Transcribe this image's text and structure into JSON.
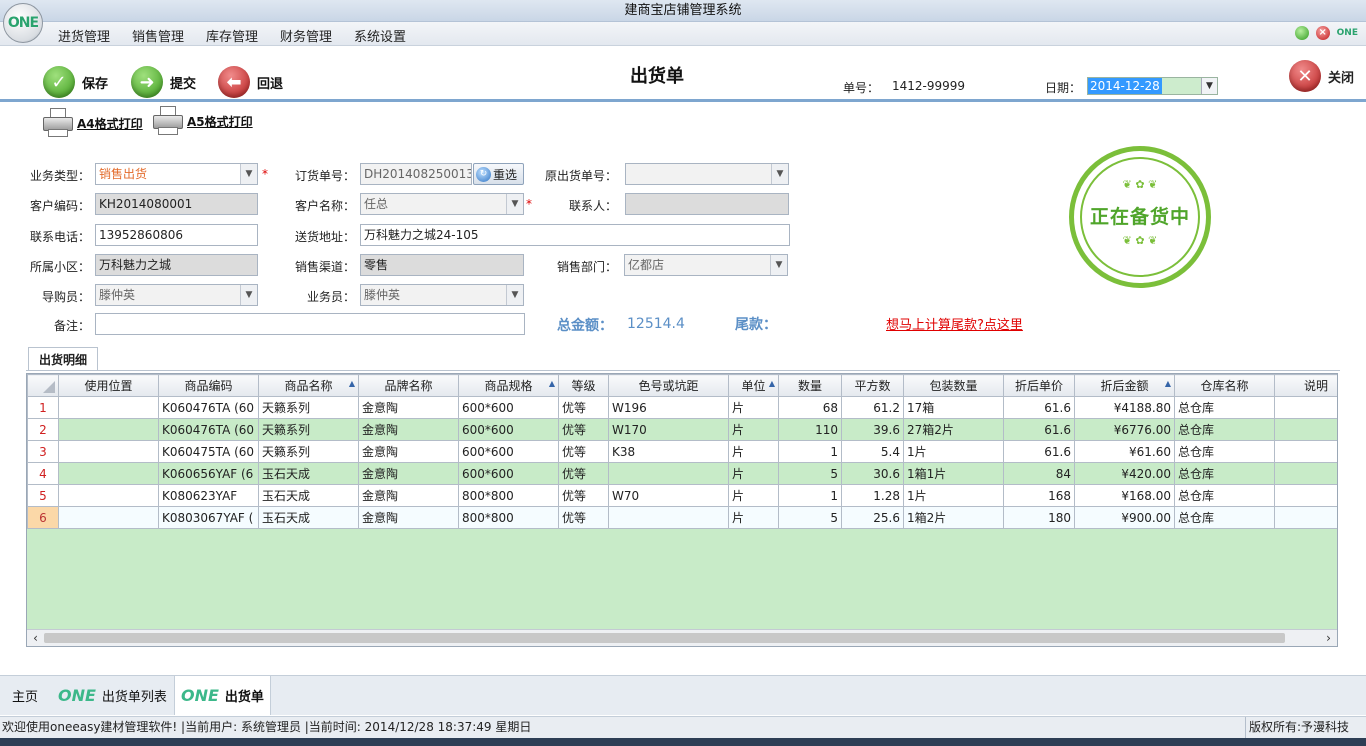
{
  "app": {
    "title": "建商宝店铺管理系统",
    "logo_text": "ONE"
  },
  "menu": [
    "进货管理",
    "销售管理",
    "库存管理",
    "财务管理",
    "系统设置"
  ],
  "tray": {
    "brand": "ONE"
  },
  "toolbar": {
    "save": "保存",
    "submit": "提交",
    "back": "回退",
    "doc_title": "出货单",
    "order_no_label": "单号：",
    "order_no": "1412-99999",
    "date_label": "日期：",
    "date": "2014-12-28",
    "close": "关闭"
  },
  "print": {
    "a4": "A4格式打印",
    "a5": "A5格式打印"
  },
  "form": {
    "biz_type_label": "业务类型：",
    "biz_type": "销售出货",
    "order_label": "订货单号：",
    "order": "DH201408250013",
    "reselect": "重选",
    "orig_label": "原出货单号：",
    "orig": "",
    "cust_code_label": "客户编码：",
    "cust_code": "KH2014080001",
    "cust_name_label": "客户名称：",
    "cust_name": "任总",
    "contact_label": "联系人：",
    "contact": "",
    "phone_label": "联系电话：",
    "phone": "13952860806",
    "addr_label": "送货地址：",
    "addr": "万科魅力之城24-105",
    "community_label": "所属小区：",
    "community": "万科魅力之城",
    "channel_label": "销售渠道：",
    "channel": "零售",
    "dept_label": "销售部门：",
    "dept": "亿都店",
    "guide_label": "导购员：",
    "guide": "滕仲英",
    "sales_label": "业务员：",
    "sales": "滕仲英",
    "remark_label": "备注：",
    "remark": "",
    "required_mark": "*"
  },
  "summary": {
    "total_label": "总金额：",
    "total": "12514.4",
    "tail_label": "尾款：",
    "calc_link": "想马上计算尾款?点这里"
  },
  "stamp": {
    "text": "正在备货中"
  },
  "detail_tab": "出货明细",
  "grid": {
    "headers": [
      "使用位置",
      "商品编码",
      "商品名称",
      "品牌名称",
      "商品规格",
      "等级",
      "色号或坑距",
      "单位",
      "数量",
      "平方数",
      "包装数量",
      "折后单价",
      "折后金额",
      "仓库名称",
      "说明"
    ],
    "rows": [
      [
        "1",
        "",
        "K060476TA (60",
        "天籁系列",
        "金意陶",
        "600*600",
        "优等",
        "W196",
        "片",
        "68",
        "61.2",
        "17箱",
        "61.6",
        "¥4188.80",
        "总仓库",
        ""
      ],
      [
        "2",
        "",
        "K060476TA (60",
        "天籁系列",
        "金意陶",
        "600*600",
        "优等",
        "W170",
        "片",
        "110",
        "39.6",
        "27箱2片",
        "61.6",
        "¥6776.00",
        "总仓库",
        ""
      ],
      [
        "3",
        "",
        "K060475TA (60",
        "天籁系列",
        "金意陶",
        "600*600",
        "优等",
        "K38",
        "片",
        "1",
        "5.4",
        "1片",
        "61.6",
        "¥61.60",
        "总仓库",
        ""
      ],
      [
        "4",
        "",
        "K060656YAF (6",
        "玉石天成",
        "金意陶",
        "600*600",
        "优等",
        "",
        "片",
        "5",
        "30.6",
        "1箱1片",
        "84",
        "¥420.00",
        "总仓库",
        ""
      ],
      [
        "5",
        "",
        "K080623YAF",
        "玉石天成",
        "金意陶",
        "800*800",
        "优等",
        "W70",
        "片",
        "1",
        "1.28",
        "1片",
        "168",
        "¥168.00",
        "总仓库",
        ""
      ],
      [
        "6",
        "",
        "K0803067YAF (",
        "玉石天成",
        "金意陶",
        "800*800",
        "优等",
        "",
        "片",
        "5",
        "25.6",
        "1箱2片",
        "180",
        "¥900.00",
        "总仓库",
        ""
      ]
    ]
  },
  "bottom_tabs": {
    "home": "主页",
    "list": "出货单列表",
    "doc": "出货单",
    "brand": "ONE"
  },
  "status": {
    "left": "欢迎使用oneeasy建材管理软件!  |当前用户: 系统管理员  |当前时间: 2014/12/28 18:37:49  星期日",
    "right": "版权所有:予漫科技"
  }
}
